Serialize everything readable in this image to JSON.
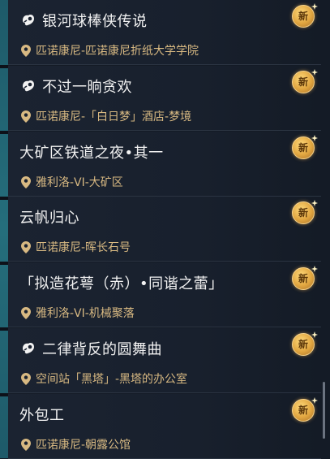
{
  "missions": [
    {
      "title": "银河球棒侠传说",
      "location": "匹诺康尼-匹诺康尼折纸大学学院",
      "has_mission_icon": true,
      "badge": "新"
    },
    {
      "title": "不过一晌贪欢",
      "location": "匹诺康尼-「白日梦」酒店-梦境",
      "has_mission_icon": true,
      "badge": "新"
    },
    {
      "title": "大矿区铁道之夜•其一",
      "location": "雅利洛-VI-大矿区",
      "has_mission_icon": false,
      "badge": "新"
    },
    {
      "title": "云帆归心",
      "location": "匹诺康尼-晖长石号",
      "has_mission_icon": false,
      "badge": "新"
    },
    {
      "title": "「拟造花萼（赤）•同谐之蕾」",
      "location": "雅利洛-VI-机械聚落",
      "has_mission_icon": false,
      "badge": "新"
    },
    {
      "title": "二律背反的圆舞曲",
      "location": "空间站「黑塔」-黑塔的办公室",
      "has_mission_icon": true,
      "badge": "新"
    },
    {
      "title": "外包工",
      "location": "匹诺康尼-朝露公馆",
      "has_mission_icon": false,
      "badge": "新"
    }
  ],
  "colors": {
    "title": "#f2f2f2",
    "location": "#d8b982",
    "badge": "#e1a640",
    "accent_stripe": "#256e7c"
  },
  "icons": {
    "mission": "mission-type-icon",
    "location": "location-pin-icon",
    "new": "new-badge-icon"
  }
}
